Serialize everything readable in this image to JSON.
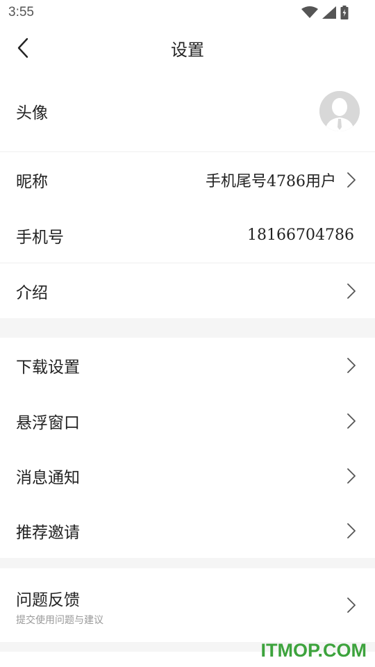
{
  "status_bar": {
    "time": "3:55",
    "icons": [
      "wifi-icon",
      "signal-icon",
      "battery-icon"
    ]
  },
  "header": {
    "title": "设置",
    "back_icon": "back-arrow-icon"
  },
  "profile": {
    "avatar_label": "头像",
    "nickname_label": "昵称",
    "nickname_value": "手机尾号4786用户",
    "phone_label": "手机号",
    "phone_value": "18166704786",
    "intro_label": "介绍"
  },
  "preferences": {
    "download_label": "下载设置",
    "floating_window_label": "悬浮窗口",
    "notifications_label": "消息通知",
    "invite_label": "推荐邀请"
  },
  "feedback": {
    "label": "问题反馈",
    "sub_label": "提交使用问题与建议"
  },
  "watermark": "ITMOP.COM",
  "colors": {
    "section_gap": "#f5f5f5",
    "divider": "#efefef",
    "watermark": "#3da33d",
    "chevron": "#555555"
  }
}
